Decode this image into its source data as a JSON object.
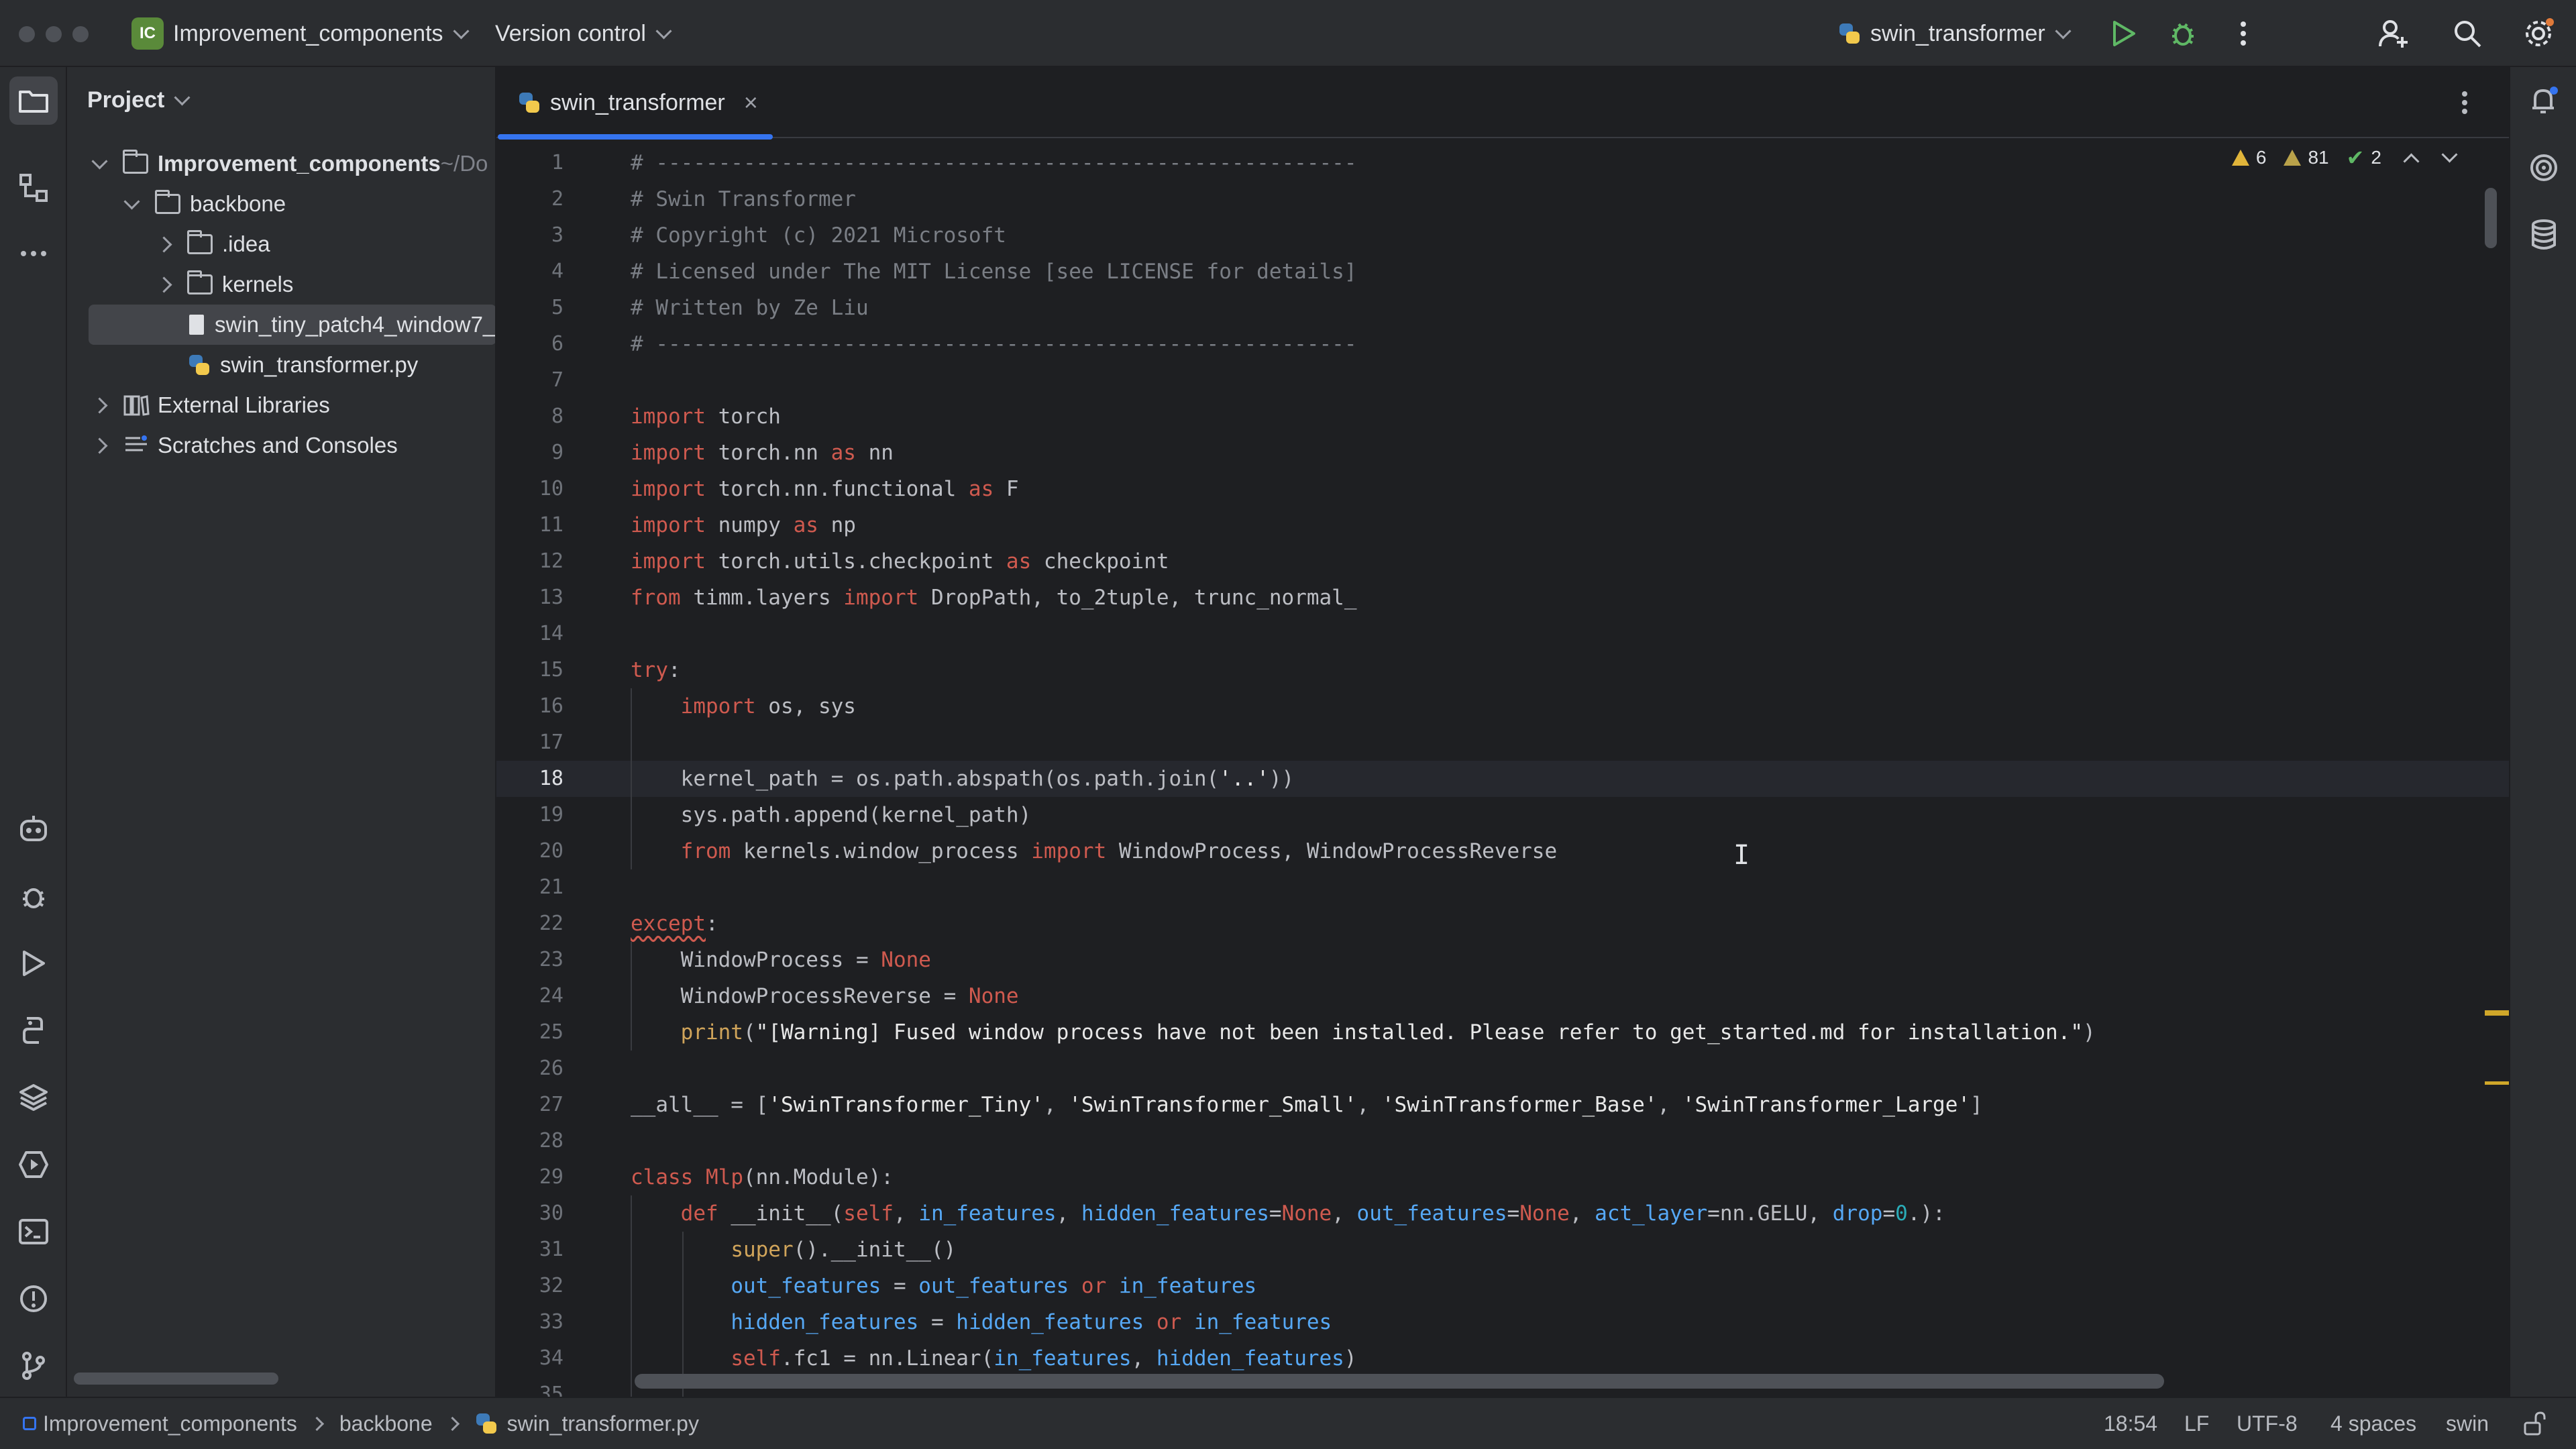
{
  "titlebar": {
    "project_badge": "IC",
    "project_name": "Improvement_components",
    "vcs": "Version control",
    "run_config": "swin_transformer"
  },
  "project_panel": {
    "title": "Project",
    "tree": [
      {
        "label": "Improvement_components",
        "suffix": " ~/Do",
        "type": "folder",
        "open": true,
        "depth": 0,
        "bold": true
      },
      {
        "label": "backbone",
        "type": "folder",
        "open": true,
        "depth": 1
      },
      {
        "label": ".idea",
        "type": "folder",
        "open": false,
        "depth": 2
      },
      {
        "label": "kernels",
        "type": "folder",
        "open": false,
        "depth": 2
      },
      {
        "label": "swin_tiny_patch4_window7_",
        "type": "file",
        "depth": 2,
        "selected": true
      },
      {
        "label": "swin_transformer.py",
        "type": "python",
        "depth": 2
      },
      {
        "label": "External Libraries",
        "type": "library",
        "open": false,
        "depth": 0
      },
      {
        "label": "Scratches and Consoles",
        "type": "scratch",
        "open": false,
        "depth": 0
      }
    ]
  },
  "editor": {
    "tab_label": "swin_transformer",
    "inspections": {
      "warnings": "6",
      "weak_warnings": "81",
      "ok": "2"
    },
    "current_line": 18,
    "lines": [
      "# --------------------------------------------------------",
      "# Swin Transformer",
      "# Copyright (c) 2021 Microsoft",
      "# Licensed under The MIT License [see LICENSE for details]",
      "# Written by Ze Liu",
      "# --------------------------------------------------------",
      "",
      "import torch",
      "import torch.nn as nn",
      "import torch.nn.functional as F",
      "import numpy as np",
      "import torch.utils.checkpoint as checkpoint",
      "from timm.layers import DropPath, to_2tuple, trunc_normal_",
      "",
      "try:",
      "    import os, sys",
      "",
      "    kernel_path = os.path.abspath(os.path.join('..'))",
      "    sys.path.append(kernel_path)",
      "    from kernels.window_process import WindowProcess, WindowProcessReverse",
      "",
      "except:",
      "    WindowProcess = None",
      "    WindowProcessReverse = None",
      "    print(\"[Warning] Fused window process have not been installed. Please refer to get_started.md for installation.\")",
      "",
      "__all__ = ['SwinTransformer_Tiny', 'SwinTransformer_Small', 'SwinTransformer_Base', 'SwinTransformer_Large']",
      "",
      "class Mlp(nn.Module):",
      "    def __init__(self, in_features, hidden_features=None, out_features=None, act_layer=nn.GELU, drop=0.):",
      "        super().__init__()",
      "        out_features = out_features or in_features",
      "        hidden_features = hidden_features or in_features",
      "        self.fc1 = nn.Linear(in_features, hidden_features)",
      ""
    ]
  },
  "statusbar": {
    "breadcrumbs": [
      "Improvement_components",
      "backbone",
      "swin_transformer.py"
    ],
    "position": "18:54",
    "line_sep": "LF",
    "encoding": "UTF-8",
    "indent": "4 spaces",
    "interpreter": "swin"
  },
  "colors": {
    "accent": "#3574f0",
    "keyword": "#cf5a4f",
    "comment": "#7a7e85",
    "param": "#56a8f5",
    "warning": "#e0b43a"
  }
}
